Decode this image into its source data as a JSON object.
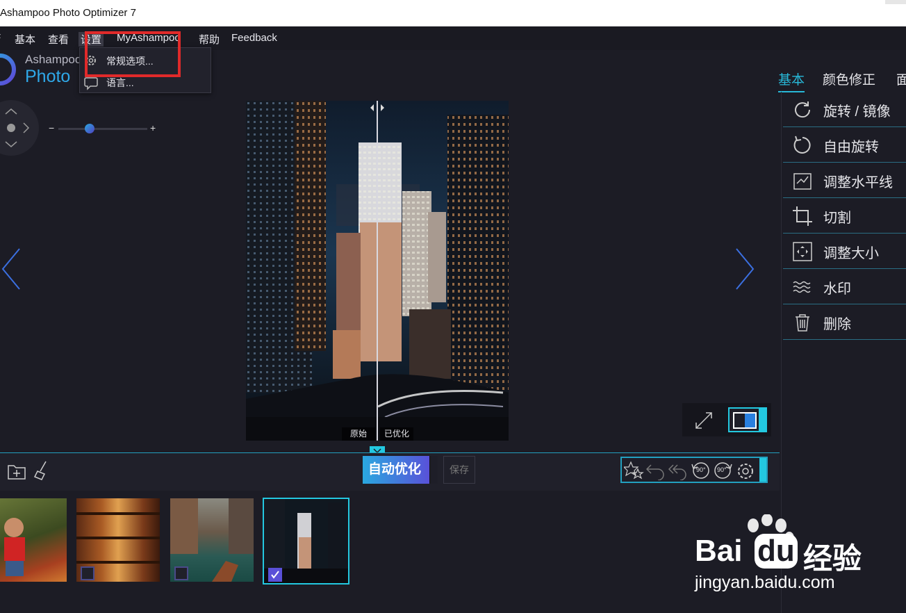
{
  "window": {
    "title": "Ashampoo Photo Optimizer 7"
  },
  "menubar": {
    "items": [
      "基本",
      "查看",
      "设置",
      "MyAshampoo",
      "帮助",
      "Feedback"
    ],
    "first_fragment": "F"
  },
  "logo": {
    "brand": "Ashampoo",
    "product": "Photo"
  },
  "settings_menu": {
    "items": [
      {
        "label": "常规选项...",
        "icon": "gear-icon"
      },
      {
        "label": "语言...",
        "icon": "speech-bubble-icon"
      }
    ]
  },
  "right_tabs": {
    "items": [
      "基本",
      "颜色修正",
      "面"
    ],
    "active": "基本"
  },
  "tools": [
    {
      "label": "旋转 / 镜像",
      "icon": "rotate-mirror-icon"
    },
    {
      "label": "自由旋转",
      "icon": "free-rotate-icon"
    },
    {
      "label": "调整水平线",
      "icon": "level-horizon-icon"
    },
    {
      "label": "切割",
      "icon": "crop-icon"
    },
    {
      "label": "调整大小",
      "icon": "resize-icon"
    },
    {
      "label": "水印",
      "icon": "watermark-icon"
    },
    {
      "label": "删除",
      "icon": "trash-icon"
    }
  ],
  "zoom": {
    "minus": "−",
    "plus": "+",
    "level": 0.35
  },
  "preview": {
    "label_original": "原始",
    "label_optimized": "已优化"
  },
  "bottom_toolbar": {
    "auto_optimize": "自动优化",
    "save": "保存",
    "rotate_left": "90°",
    "rotate_right": "90°"
  },
  "filmstrip": {
    "selected_index": 3,
    "count": 4
  },
  "watermark": {
    "brand_text": "Bai",
    "brand_text2": "du",
    "brand_suffix": "经验",
    "url": "jingyan.baidu.com"
  },
  "colors": {
    "accent_cyan": "#28b8d8",
    "highlight_red": "#e02a2a",
    "gradient_start": "#2aa8e0",
    "gradient_end": "#5f46d8"
  }
}
